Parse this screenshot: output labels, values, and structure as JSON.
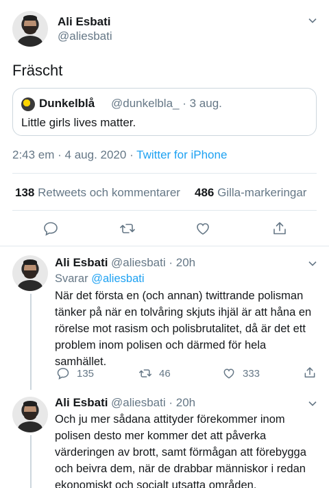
{
  "main_tweet": {
    "author_name": "Ali Esbati",
    "author_handle": "@aliesbati",
    "text": "Fräscht",
    "quoted": {
      "author_name": "Dunkelblå",
      "meta": "@dunkelbla_ · 3 aug.",
      "text": "Little girls lives matter."
    },
    "time_date": "2:43 em · 4 aug. 2020 · ",
    "source": "Twitter for iPhone",
    "retweets_count": "138",
    "retweets_label": "Retweets och kommentarer",
    "likes_count": "486",
    "likes_label": "Gilla-markeringar"
  },
  "replies": [
    {
      "author_name": "Ali Esbati",
      "meta": "@aliesbati · 20h",
      "replying_label": "Svarar",
      "replying_to": "@aliesbati",
      "lines": [
        "När det första en (och annan) twittrande polisman",
        "tänker på när en tolvåring skjuts ihjäl är att håna en",
        "rörelse mot rasism och polisbrutalitet, då är det ett",
        "problem inom polisen och därmed för hela",
        "samhället."
      ],
      "reply_count": "135",
      "retweet_count": "46",
      "like_count": "333"
    },
    {
      "author_name": "Ali Esbati",
      "meta": "@aliesbati · 20h",
      "lines": [
        "Och ju mer sådana attityder förekommer inom",
        "polisen desto mer kommer det att påverka",
        "värderingen av brott, samt förmågan att förebygga",
        "och beivra dem, när de drabbar människor i redan",
        "ekonomiskt och socialt utsatta områden."
      ]
    }
  ],
  "icons": [
    "chevron-down-icon",
    "reply-icon",
    "retweet-icon",
    "like-icon",
    "share-icon"
  ],
  "colors": {
    "link": "#1da1f2",
    "muted": "#657786",
    "text": "#14171a",
    "divider": "#e1e8ed"
  }
}
